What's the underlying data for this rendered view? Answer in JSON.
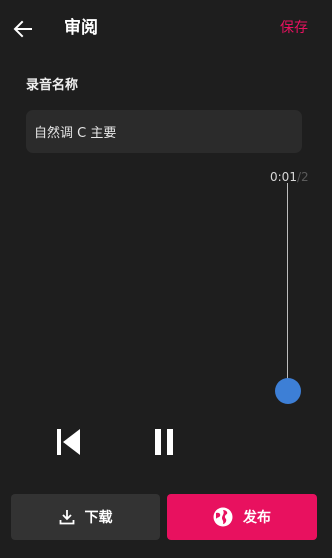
{
  "colors": {
    "accent": "#e8115f",
    "thumb": "#3d7fd6",
    "background": "#1e1e1e"
  },
  "header": {
    "back_icon": "arrow-left-icon",
    "title": "审阅",
    "save_label": "保存"
  },
  "form": {
    "name_label": "录音名称",
    "name_value": "自然调 C 主要"
  },
  "player": {
    "time_current": "0:01",
    "time_overflow": "/2",
    "progress_fraction": 1.0,
    "prev_icon": "skip-previous-icon",
    "pause_icon": "pause-icon"
  },
  "actions": {
    "download_label": "下载",
    "download_icon": "download-icon",
    "publish_label": "发布",
    "publish_icon": "globe-icon"
  }
}
